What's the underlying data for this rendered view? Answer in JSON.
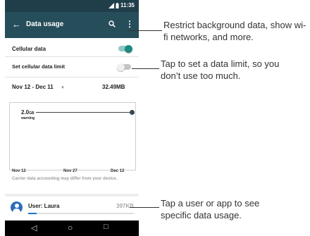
{
  "status_bar": {
    "time": "11:35"
  },
  "app_bar": {
    "back_icon": "arrow-back-icon",
    "title": "Data usage",
    "search_icon": "search-icon",
    "overflow_icon": "more-vert-icon"
  },
  "settings": {
    "cellular_data": {
      "label": "Cellular data",
      "enabled": true
    },
    "set_limit": {
      "label": "Set cellular data limit",
      "enabled": false
    }
  },
  "cycle": {
    "range": "Nov 12 - Dec 11",
    "total": "32.49MB"
  },
  "chart": {
    "warning_value": "2.0",
    "warning_unit": "GB",
    "warning_label": "warning",
    "ticks": [
      "Nov 12",
      "Nov 27",
      "Dec 12"
    ]
  },
  "note": "Carrier data accounting may differ from your device.",
  "user_row": {
    "label": "User: Laura",
    "amount": "397KB"
  },
  "nav": {
    "back": "◁",
    "home": "○",
    "recents": "□"
  },
  "callouts": {
    "restrict": "Restrict background data, show wi-fi networks, and more.",
    "limit": "Tap to set a data limit, so you don’t use too much.",
    "user": "Tap a user or app to see specific data usage."
  },
  "colors": {
    "app_bar": "#264d5a",
    "status_bar": "#1f3e49",
    "accent": "#1f8a82"
  }
}
